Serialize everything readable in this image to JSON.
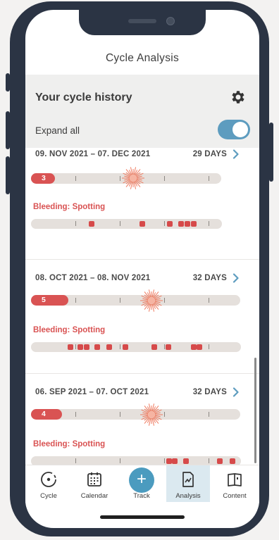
{
  "nav": {
    "title": "Cycle Analysis"
  },
  "header": {
    "title": "Your cycle history",
    "expand_label": "Expand all",
    "expand_on": true
  },
  "cycles": [
    {
      "date_range": "09. NOV 2021 – 07. DEC 2021",
      "days": "29 DAYS",
      "period_days": "3",
      "bleeding_label": "Bleeding: Spotting"
    },
    {
      "date_range": "08. OCT 2021 – 08. NOV 2021",
      "days": "32 DAYS",
      "period_days": "5",
      "bleeding_label": "Bleeding: Spotting"
    },
    {
      "date_range": "06. SEP 2021 – 07. OCT 2021",
      "days": "32 DAYS",
      "period_days": "4",
      "bleeding_label": "Bleeding: Spotting"
    }
  ],
  "tabs": [
    {
      "label": "Cycle",
      "icon": "cycle-icon"
    },
    {
      "label": "Calendar",
      "icon": "calendar-icon"
    },
    {
      "label": "Track",
      "icon": "plus-icon"
    },
    {
      "label": "Analysis",
      "icon": "analysis-icon",
      "active": true
    },
    {
      "label": "Content",
      "icon": "book-icon"
    }
  ],
  "colors": {
    "accent": "#4b9bbf",
    "period": "#d95353",
    "bar": "#e5e0dc",
    "ovulation": "#ef7a5f"
  }
}
